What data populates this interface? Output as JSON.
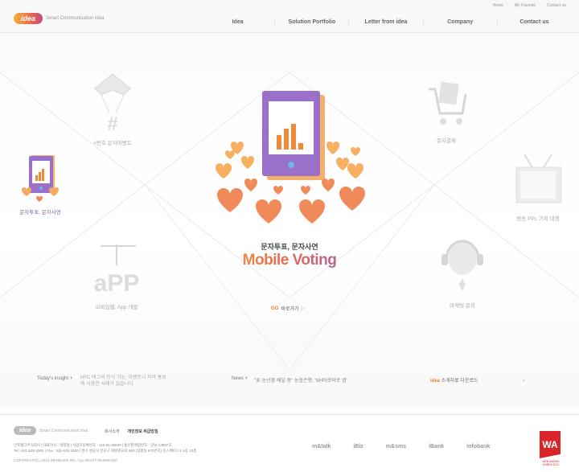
{
  "header": {
    "util_links": [
      "Home",
      "My Favorite",
      "Contact us"
    ],
    "logo_text": "idea",
    "logo_tagline": "Smart Communication idea",
    "nav": [
      "Idea",
      "Solution Portfolio",
      "Letter from idea",
      "Company",
      "Contact us"
    ]
  },
  "items": {
    "event": "#번호 문자이벤트",
    "payment": "문자결제",
    "vote_small": "문자투표, 문자사연",
    "ppl": "방송 PPL 기획 대행",
    "app": "모바일웹, App 개발",
    "marketing": "마케팅 문의"
  },
  "featured": {
    "title_kr": "문자투표, 문자사연",
    "title_en": "Mobile Voting",
    "go_label": "GO",
    "go_text": "바로가기"
  },
  "infobar": {
    "insight_label": "Today's insight +",
    "insight_text": "NFC 태그의 인식 기능, 이벤트시 지역 홍보에 사용한 사례가 있습니다",
    "news_label": "News +",
    "news_text": "\"꽃·농산품 배달 중\" 농협은행, 'NH바로바로 앱'",
    "download_brand": "idea",
    "download_text": "소개자료 다운로드",
    "download_arrow": "›"
  },
  "footer": {
    "logo_text": "idea",
    "logo_tagline": "Smart Communication idea",
    "links": [
      "회사소개",
      "개인정보 취급방침"
    ],
    "address_1": "인포뱅크주식회사 | 대표이사 : 박태형 | 사업자등록번호 : 116-81-46839 | 통신판매업번호 : 강남-13897호",
    "address_2": "Tel : 031-628-1500 | Fax : 031-628-1600 | 경기 성남시 분당구 대왕판교로 660 (삼평동 670번지) 유스페이스1 A동 10층",
    "copyright": "COPYRIGHT(C) 2012 INFOBANK INC. ALL RIGHT RESERVED",
    "family_sites": [
      "m&talk",
      "iBiz",
      "m&sms",
      "iBank",
      "infobank"
    ],
    "award_logo": "WA",
    "award_text": "WEB AWARD KOREA 2012"
  },
  "colors": {
    "accent_orange": "#e8841c",
    "award_red": "#d9242a",
    "phone_purple": "#9b70c8"
  }
}
